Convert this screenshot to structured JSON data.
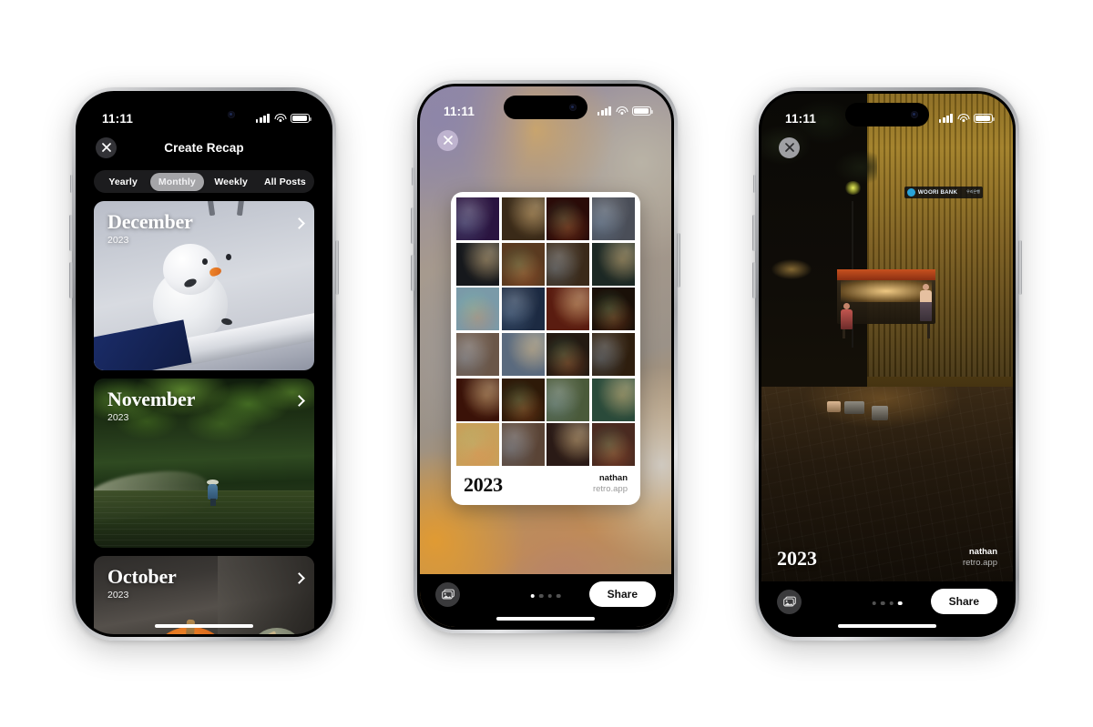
{
  "meta": {
    "background_color": "#ffffff",
    "accent_white": "#ffffff",
    "dark_bg": "#000000"
  },
  "status_bar": {
    "time": "11:11",
    "signal_icon": "cellular-bars-icon",
    "wifi_icon": "wifi-icon",
    "battery_icon": "battery-icon"
  },
  "phone1": {
    "nav": {
      "title": "Create Recap",
      "close_label": "×"
    },
    "segmented": {
      "options": [
        "Yearly",
        "Monthly",
        "Weekly",
        "All Posts"
      ],
      "selected": "Monthly",
      "selected_index": 1
    },
    "cards": [
      {
        "title": "December",
        "year": "2023",
        "art": "snowman-on-snow"
      },
      {
        "title": "November",
        "year": "2023",
        "art": "forest-river-wader"
      },
      {
        "title": "October",
        "year": "2023",
        "art": "pumpkin-on-porch"
      }
    ]
  },
  "phone2": {
    "close_label": "×",
    "collage": {
      "columns": 4,
      "rows": 6,
      "count": 24,
      "footer_year": "2023",
      "footer_user": "nathan",
      "footer_app": "retro.app",
      "tiles": [
        "#2a1440",
        "#3a2a18",
        "#2a0b08",
        "#4a4e58",
        "#16181c",
        "#5a3a20",
        "#3a2a1a",
        "#1c2824",
        "#7a9aa8",
        "#1c2a42",
        "#5a1c10",
        "#1a1008",
        "#6a5648",
        "#5a6a7e",
        "#241a12",
        "#2e1e0e",
        "#3a1208",
        "#2e1a08",
        "#4a5a3a",
        "#2a4a3a",
        "#c8a05a",
        "#5a4436",
        "#2a1a16",
        "#4a2a20"
      ]
    },
    "bottom": {
      "stack_icon": "photo-stack-icon",
      "share_label": "Share",
      "dots_total": 4,
      "dots_active_index": 0
    }
  },
  "phone3": {
    "close_label": "×",
    "photo": {
      "description": "night street food cart",
      "sign_text": "WOORI BANK",
      "sign_sub": "우리은행"
    },
    "overlay": {
      "year": "2023",
      "user": "nathan",
      "app": "retro.app"
    },
    "bottom": {
      "stack_icon": "photo-stack-icon",
      "share_label": "Share",
      "dots_total": 4,
      "dots_active_index": 3
    }
  }
}
